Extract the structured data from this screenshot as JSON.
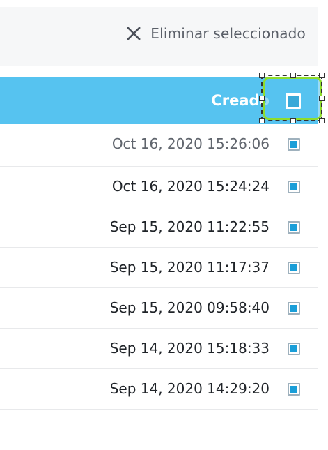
{
  "toolbar": {
    "delete_label": "Eliminar seleccionado",
    "delete_icon": "close-icon"
  },
  "table": {
    "column_header": "Creado",
    "accent_color": "#56c3f0",
    "rows": [
      {
        "created": "Oct 16, 2020 15:26:06",
        "selected": true
      },
      {
        "created": "Oct 16, 2020 15:24:24",
        "selected": true
      },
      {
        "created": "Sep 15, 2020 11:22:55",
        "selected": true
      },
      {
        "created": "Sep 15, 2020 11:17:37",
        "selected": true
      },
      {
        "created": "Sep 15, 2020 09:58:40",
        "selected": true
      },
      {
        "created": "Sep 14, 2020 15:18:33",
        "selected": true
      },
      {
        "created": "Sep 14, 2020 14:29:20",
        "selected": true
      }
    ]
  }
}
